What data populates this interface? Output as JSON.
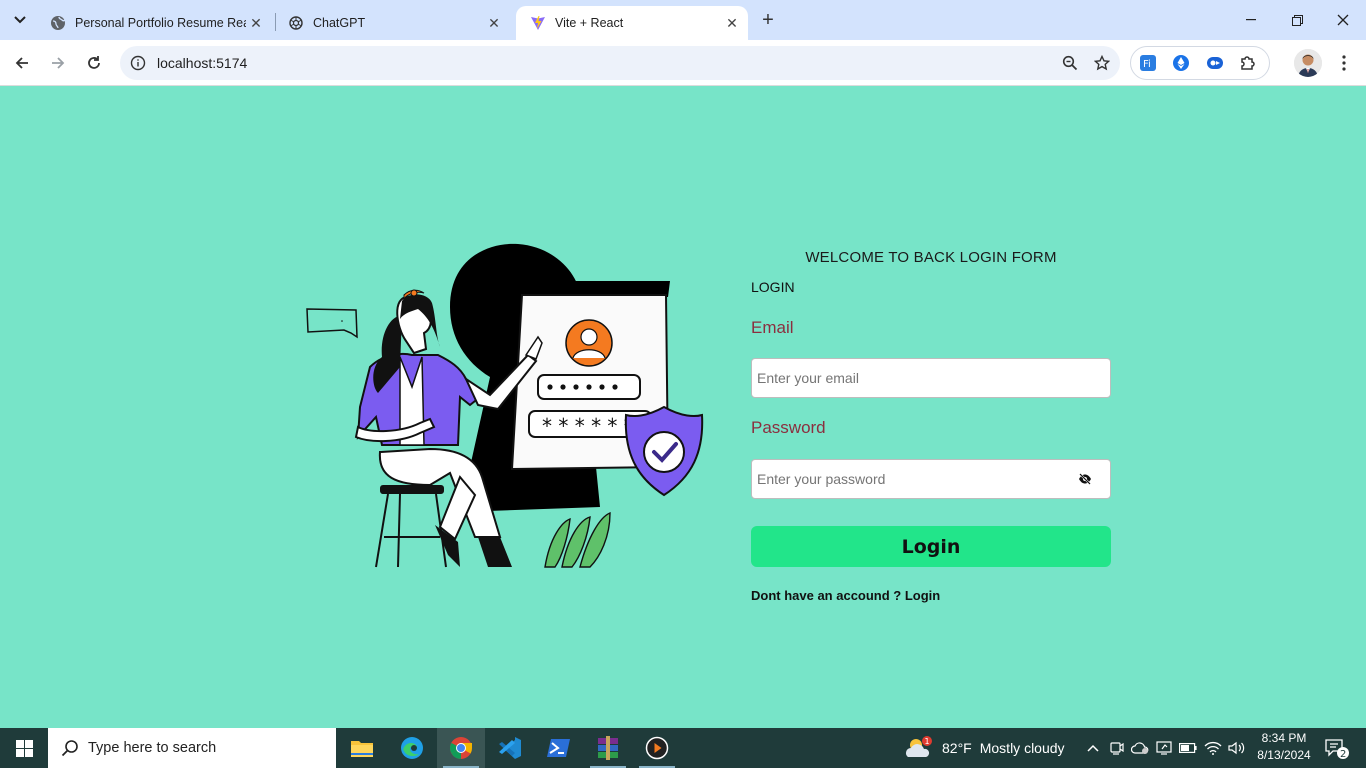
{
  "browser": {
    "tabs": [
      {
        "title": "Personal Portfolio Resume Reac",
        "favicon": "globe-icon",
        "active": false
      },
      {
        "title": "ChatGPT",
        "favicon": "chatgpt-icon",
        "active": false
      },
      {
        "title": "Vite + React",
        "favicon": "vite-icon",
        "active": true
      }
    ],
    "url": "localhost:5174"
  },
  "form": {
    "welcome": "WELCOME TO BACK LOGIN FORM",
    "heading": "LOGIN",
    "email_label": "Email",
    "email_placeholder": "Enter your email",
    "password_label": "Password",
    "password_placeholder": "Enter your password",
    "login_button": "Login",
    "signup_text": "Dont have an accound ? Login"
  },
  "taskbar": {
    "search_placeholder": "Type here to search",
    "weather_temp": "82°F",
    "weather_desc": "Mostly cloudy",
    "weather_badge": "1",
    "time": "8:34 PM",
    "date": "8/13/2024",
    "notification_count": "2"
  },
  "colors": {
    "page_bg": "#77e4c8",
    "button": "#22e58a",
    "label": "#8b2f3f",
    "accent_purple": "#7b5cf0",
    "accent_orange": "#f47a20"
  }
}
